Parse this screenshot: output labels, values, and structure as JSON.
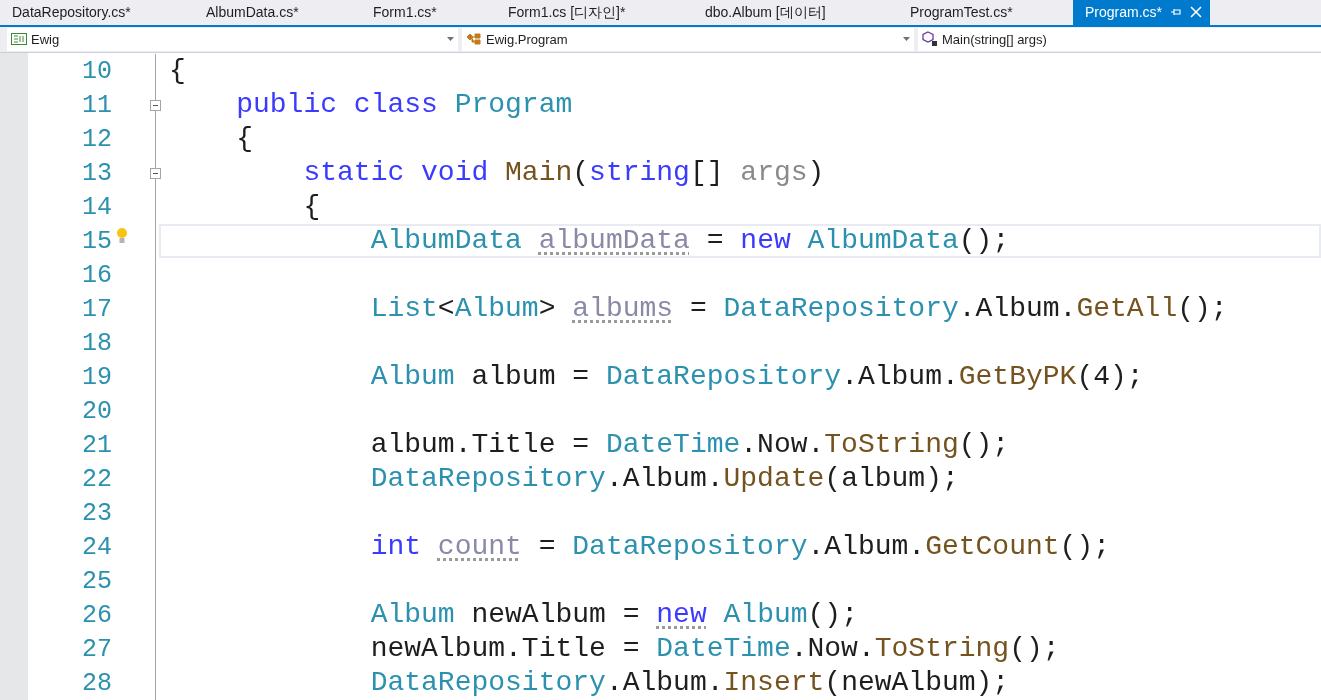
{
  "tabs": [
    {
      "label": "DataRepository.cs*",
      "selected": false
    },
    {
      "label": "AlbumData.cs*",
      "selected": false
    },
    {
      "label": "Form1.cs*",
      "selected": false
    },
    {
      "label": "Form1.cs [디자인]*",
      "selected": false
    },
    {
      "label": "dbo.Album [데이터]",
      "selected": false
    },
    {
      "label": "ProgramTest.cs*",
      "selected": false
    },
    {
      "label": "Program.cs*",
      "selected": true
    }
  ],
  "navigation_bar": {
    "project": "Ewig",
    "type": "Ewig.Program",
    "member": "Main(string[] args)"
  },
  "code_lines": [
    {
      "number": "10",
      "fold": false,
      "lightbulb": false,
      "current": false,
      "tokens": [
        {
          "text": "{",
          "kind": "plain"
        }
      ]
    },
    {
      "number": "11",
      "fold": true,
      "lightbulb": false,
      "current": false,
      "tokens": [
        {
          "text": "    public class",
          "kind": "kw"
        },
        {
          "text": " Program",
          "kind": "type"
        }
      ]
    },
    {
      "number": "12",
      "fold": false,
      "lightbulb": false,
      "current": false,
      "tokens": [
        {
          "text": "    {",
          "kind": "plain"
        }
      ]
    },
    {
      "number": "13",
      "fold": true,
      "lightbulb": false,
      "current": false,
      "tokens": [
        {
          "text": "        static void",
          "kind": "kw"
        },
        {
          "text": " Main",
          "kind": "method"
        },
        {
          "text": "(",
          "kind": "plain"
        },
        {
          "text": "string",
          "kind": "kw"
        },
        {
          "text": "[] ",
          "kind": "plain"
        },
        {
          "text": "args",
          "kind": "param"
        },
        {
          "text": ")",
          "kind": "plain"
        }
      ]
    },
    {
      "number": "14",
      "fold": false,
      "lightbulb": false,
      "current": false,
      "tokens": [
        {
          "text": "        {",
          "kind": "plain"
        }
      ]
    },
    {
      "number": "15",
      "fold": false,
      "lightbulb": true,
      "current": true,
      "tokens": [
        {
          "text": "            AlbumData ",
          "kind": "type"
        },
        {
          "text": "albumData",
          "kind": "unused"
        },
        {
          "text": " = ",
          "kind": "plain"
        },
        {
          "text": "new",
          "kind": "kw"
        },
        {
          "text": " AlbumData",
          "kind": "type"
        },
        {
          "text": "();",
          "kind": "plain"
        }
      ]
    },
    {
      "number": "16",
      "fold": false,
      "lightbulb": false,
      "current": false
    },
    {
      "number": "17",
      "fold": false,
      "lightbulb": false,
      "current": false,
      "tokens": [
        {
          "text": "            List",
          "kind": "type"
        },
        {
          "text": "<",
          "kind": "plain"
        },
        {
          "text": "Album",
          "kind": "type"
        },
        {
          "text": "> ",
          "kind": "plain"
        },
        {
          "text": "albums",
          "kind": "unused"
        },
        {
          "text": " = ",
          "kind": "plain"
        },
        {
          "text": "DataRepository",
          "kind": "type"
        },
        {
          "text": ".Album.",
          "kind": "plain"
        },
        {
          "text": "GetAll",
          "kind": "method"
        },
        {
          "text": "();",
          "kind": "plain"
        }
      ]
    },
    {
      "number": "18",
      "fold": false,
      "lightbulb": false,
      "current": false
    },
    {
      "number": "19",
      "fold": false,
      "lightbulb": false,
      "current": false,
      "tokens": [
        {
          "text": "            Album",
          "kind": "type"
        },
        {
          "text": " album = ",
          "kind": "plain"
        },
        {
          "text": "DataRepository",
          "kind": "type"
        },
        {
          "text": ".Album.",
          "kind": "plain"
        },
        {
          "text": "GetByPK",
          "kind": "method"
        },
        {
          "text": "(4);",
          "kind": "plain"
        }
      ]
    },
    {
      "number": "20",
      "fold": false,
      "lightbulb": false,
      "current": false
    },
    {
      "number": "21",
      "fold": false,
      "lightbulb": false,
      "current": false,
      "tokens": [
        {
          "text": "            album.Title = ",
          "kind": "plain"
        },
        {
          "text": "DateTime",
          "kind": "type"
        },
        {
          "text": ".Now.",
          "kind": "plain"
        },
        {
          "text": "ToString",
          "kind": "method"
        },
        {
          "text": "();",
          "kind": "plain"
        }
      ]
    },
    {
      "number": "22",
      "fold": false,
      "lightbulb": false,
      "current": false,
      "tokens": [
        {
          "text": "            DataRepository",
          "kind": "type"
        },
        {
          "text": ".Album.",
          "kind": "plain"
        },
        {
          "text": "Update",
          "kind": "method"
        },
        {
          "text": "(album);",
          "kind": "plain"
        }
      ]
    },
    {
      "number": "23",
      "fold": false,
      "lightbulb": false,
      "current": false
    },
    {
      "number": "24",
      "fold": false,
      "lightbulb": false,
      "current": false,
      "tokens": [
        {
          "text": "            int ",
          "kind": "kw"
        },
        {
          "text": "count",
          "kind": "unused"
        },
        {
          "text": " = ",
          "kind": "plain"
        },
        {
          "text": "DataRepository",
          "kind": "type"
        },
        {
          "text": ".Album.",
          "kind": "plain"
        },
        {
          "text": "GetCount",
          "kind": "method"
        },
        {
          "text": "();",
          "kind": "plain"
        }
      ]
    },
    {
      "number": "25",
      "fold": false,
      "lightbulb": false,
      "current": false
    },
    {
      "number": "26",
      "fold": false,
      "lightbulb": false,
      "current": false,
      "tokens": [
        {
          "text": "            Album",
          "kind": "type"
        },
        {
          "text": " newAlbum = ",
          "kind": "plain"
        },
        {
          "text": "new",
          "kind": "kw_hint"
        },
        {
          "text": " Album",
          "kind": "type"
        },
        {
          "text": "();",
          "kind": "plain"
        }
      ]
    },
    {
      "number": "27",
      "fold": false,
      "lightbulb": false,
      "current": false,
      "tokens": [
        {
          "text": "            newAlbum.Title = ",
          "kind": "plain"
        },
        {
          "text": "DateTime",
          "kind": "type"
        },
        {
          "text": ".Now.",
          "kind": "plain"
        },
        {
          "text": "ToString",
          "kind": "method"
        },
        {
          "text": "();",
          "kind": "plain"
        }
      ]
    },
    {
      "number": "28",
      "fold": false,
      "lightbulb": false,
      "current": false,
      "tokens": [
        {
          "text": "            DataRepository",
          "kind": "type"
        },
        {
          "text": ".Album.",
          "kind": "plain"
        },
        {
          "text": "Insert",
          "kind": "method"
        },
        {
          "text": "(newAlbum);",
          "kind": "plain"
        }
      ]
    }
  ]
}
